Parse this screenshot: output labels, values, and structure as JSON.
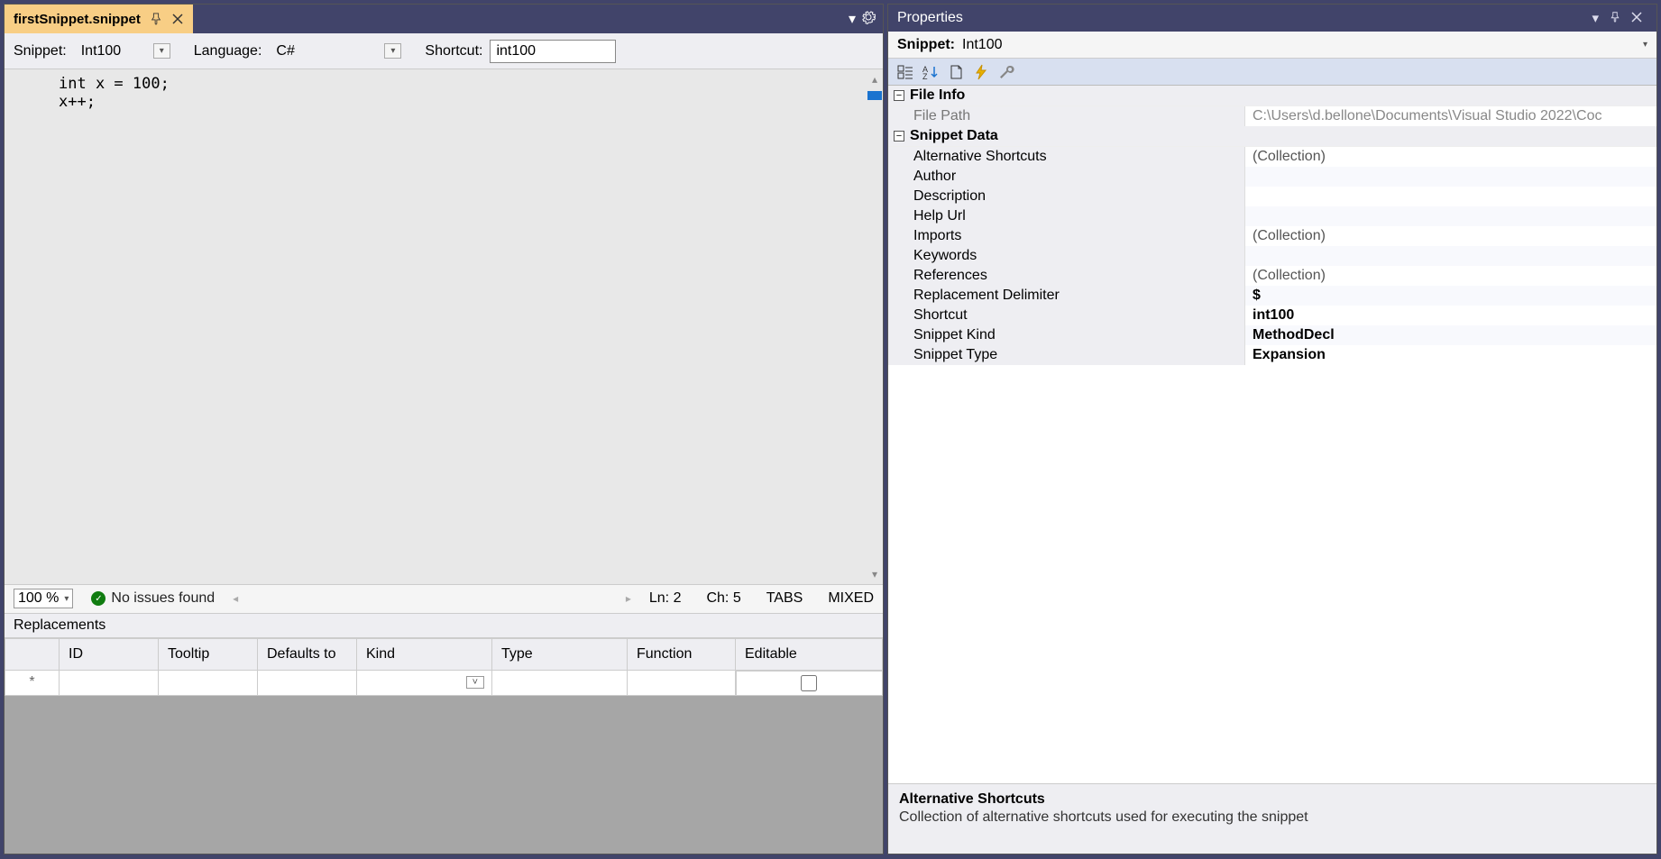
{
  "tab": {
    "title": "firstSnippet.snippet"
  },
  "header": {
    "snippet_label": "Snippet:",
    "snippet_value": "Int100",
    "language_label": "Language:",
    "language_value": "C#",
    "shortcut_label": "Shortcut:",
    "shortcut_value": "int100"
  },
  "code": "int x = 100;\nx++;",
  "status": {
    "zoom": "100 %",
    "issues": "No issues found",
    "ln": "Ln: 2",
    "ch": "Ch: 5",
    "tabs": "TABS",
    "mixed": "MIXED"
  },
  "replacements": {
    "title": "Replacements",
    "columns": [
      "",
      "ID",
      "Tooltip",
      "Defaults to",
      "Kind",
      "Type",
      "Function",
      "Editable"
    ],
    "row_marker": "*"
  },
  "properties": {
    "panel_title": "Properties",
    "selector_label": "Snippet:",
    "selector_value": "Int100",
    "cat_file": "File Info",
    "file_path_key": "File Path",
    "file_path_val": "C:\\Users\\d.bellone\\Documents\\Visual Studio 2022\\Coc",
    "cat_data": "Snippet Data",
    "rows": {
      "alt_shortcuts_key": "Alternative Shortcuts",
      "alt_shortcuts_val": "(Collection)",
      "author_key": "Author",
      "author_val": "",
      "description_key": "Description",
      "description_val": "",
      "help_url_key": "Help Url",
      "help_url_val": "",
      "imports_key": "Imports",
      "imports_val": "(Collection)",
      "keywords_key": "Keywords",
      "keywords_val": "",
      "references_key": "References",
      "references_val": "(Collection)",
      "delim_key": "Replacement Delimiter",
      "delim_val": "$",
      "shortcut_key": "Shortcut",
      "shortcut_val": "int100",
      "kind_key": "Snippet Kind",
      "kind_val": "MethodDecl",
      "type_key": "Snippet Type",
      "type_val": "Expansion"
    },
    "desc_title": "Alternative Shortcuts",
    "desc_body": "Collection of alternative shortcuts used for executing the snippet"
  }
}
